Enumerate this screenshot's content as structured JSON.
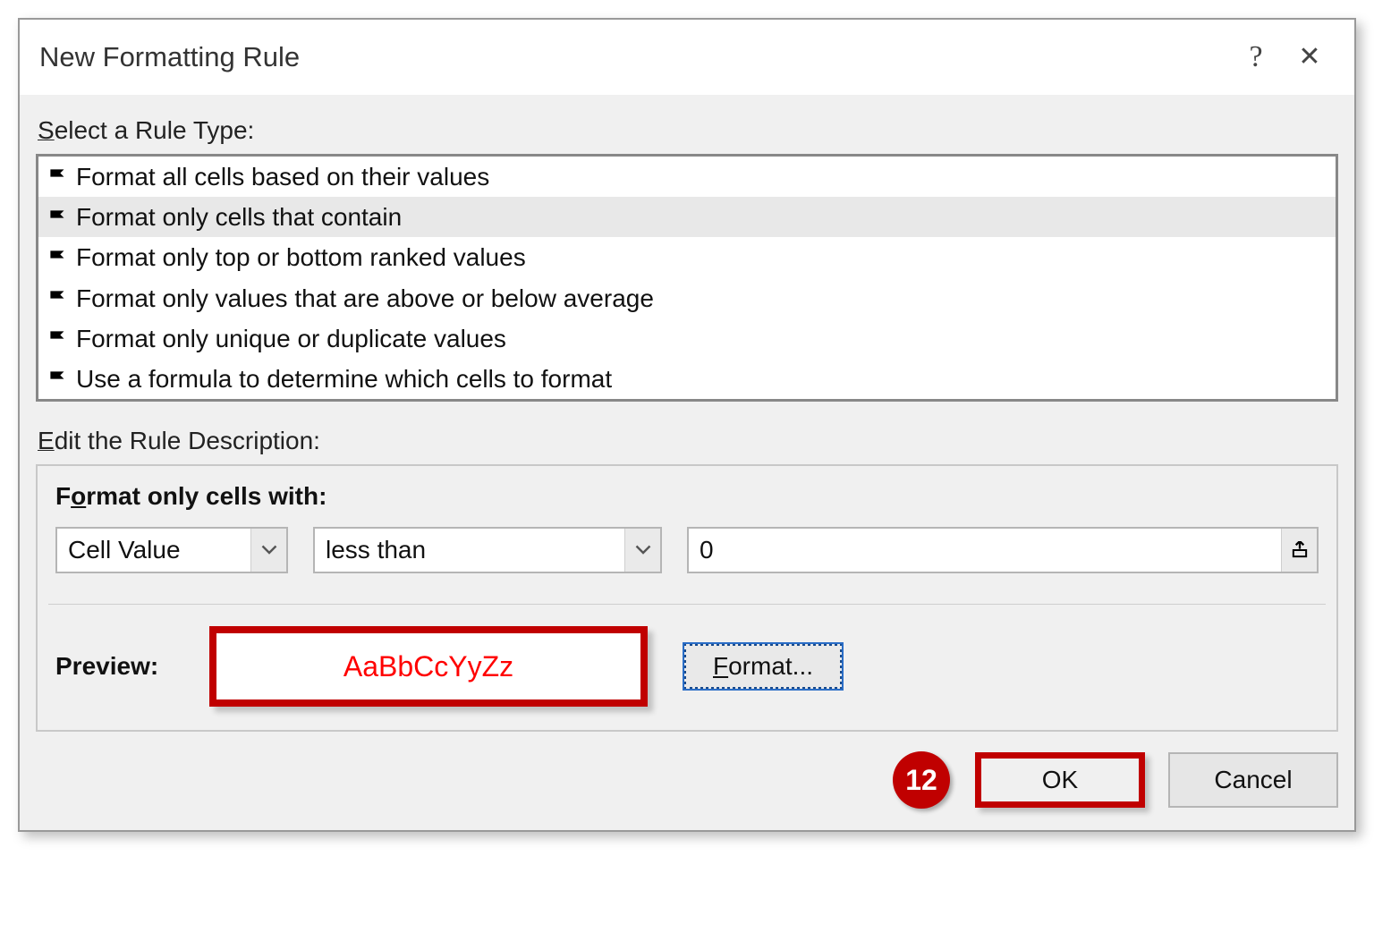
{
  "titlebar": {
    "title": "New Formatting Rule"
  },
  "sections": {
    "select_label_prefix": "S",
    "select_label_rest": "elect a Rule Type:",
    "edit_label_prefix": "E",
    "edit_label_rest": "dit the Rule Description:"
  },
  "rule_types": [
    "Format all cells based on their values",
    "Format only cells that contain",
    "Format only top or bottom ranked values",
    "Format only values that are above or below average",
    "Format only unique or duplicate values",
    "Use a formula to determine which cells to format"
  ],
  "description": {
    "heading_pre": "F",
    "heading_ul": "o",
    "heading_post": "rmat only cells with:",
    "combo1": "Cell Value",
    "combo2": "less than",
    "value": "0",
    "preview_label": "Preview:",
    "preview_text": "AaBbCcYyZz",
    "format_btn_ul": "F",
    "format_btn_rest": "ormat..."
  },
  "footer": {
    "step_badge": "12",
    "ok": "OK",
    "cancel": "Cancel"
  }
}
